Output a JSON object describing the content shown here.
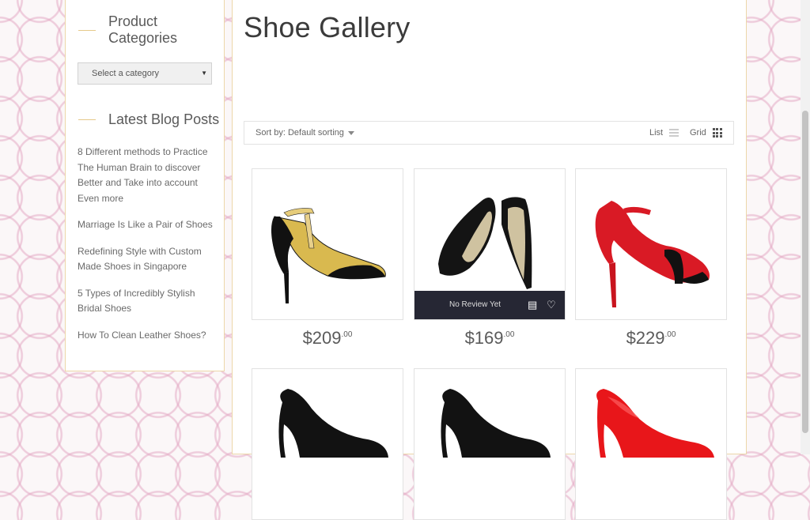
{
  "sidebar": {
    "categories_title_line1": "Product",
    "categories_title_line2": "Categories",
    "select_placeholder": "Select a category",
    "blog_title": "Latest Blog Posts",
    "posts": [
      "8 Different methods to Practice The Human Brain to discover Better and Take into account Even more",
      "Marriage Is Like a Pair of Shoes",
      "Redefining Style with Custom Made Shoes in Singapore",
      "5 Types of Incredibly Stylish Bridal Shoes",
      "How To Clean Leather Shoes?"
    ]
  },
  "main": {
    "title": "Shoe Gallery",
    "sort_label": "Sort by: Default sorting",
    "view_list_label": "List",
    "view_grid_label": "Grid"
  },
  "products": [
    {
      "price_main": "$209",
      "price_cents": ".00",
      "image": "gold-black-t-strap-heel"
    },
    {
      "price_main": "$169",
      "price_cents": ".00",
      "image": "black-pointed-flats",
      "overlay_label": "No Review Yet"
    },
    {
      "price_main": "$229",
      "price_cents": ".00",
      "image": "red-black-ankle-strap-heel"
    },
    {
      "image": "black-pump-heel"
    },
    {
      "image": "black-pump-heel"
    },
    {
      "image": "red-patent-pump-heel"
    }
  ],
  "colors": {
    "accent_border": "#ecd7a9",
    "overlay_bg": "#262734",
    "pattern": "#e4aac4"
  }
}
